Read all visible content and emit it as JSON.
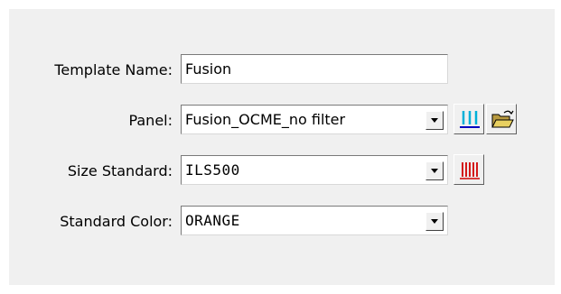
{
  "form": {
    "template_name": {
      "label": "Template Name:",
      "value": "Fusion"
    },
    "panel": {
      "label": "Panel:",
      "value": "Fusion_OCME_no filter",
      "panel_icon": "panel-bins-icon",
      "open_icon": "open-folder-icon"
    },
    "size_standard": {
      "label": "Size Standard:",
      "value": "ILS500",
      "icon": "size-standard-peaks-icon"
    },
    "standard_color": {
      "label": "Standard Color:",
      "value": "ORANGE"
    }
  },
  "colors": {
    "panel_icon_cyan": "#00b0d8",
    "panel_icon_blue": "#0000c0",
    "size_icon_red": "#d00000",
    "folder_yellow": "#e8d060"
  }
}
